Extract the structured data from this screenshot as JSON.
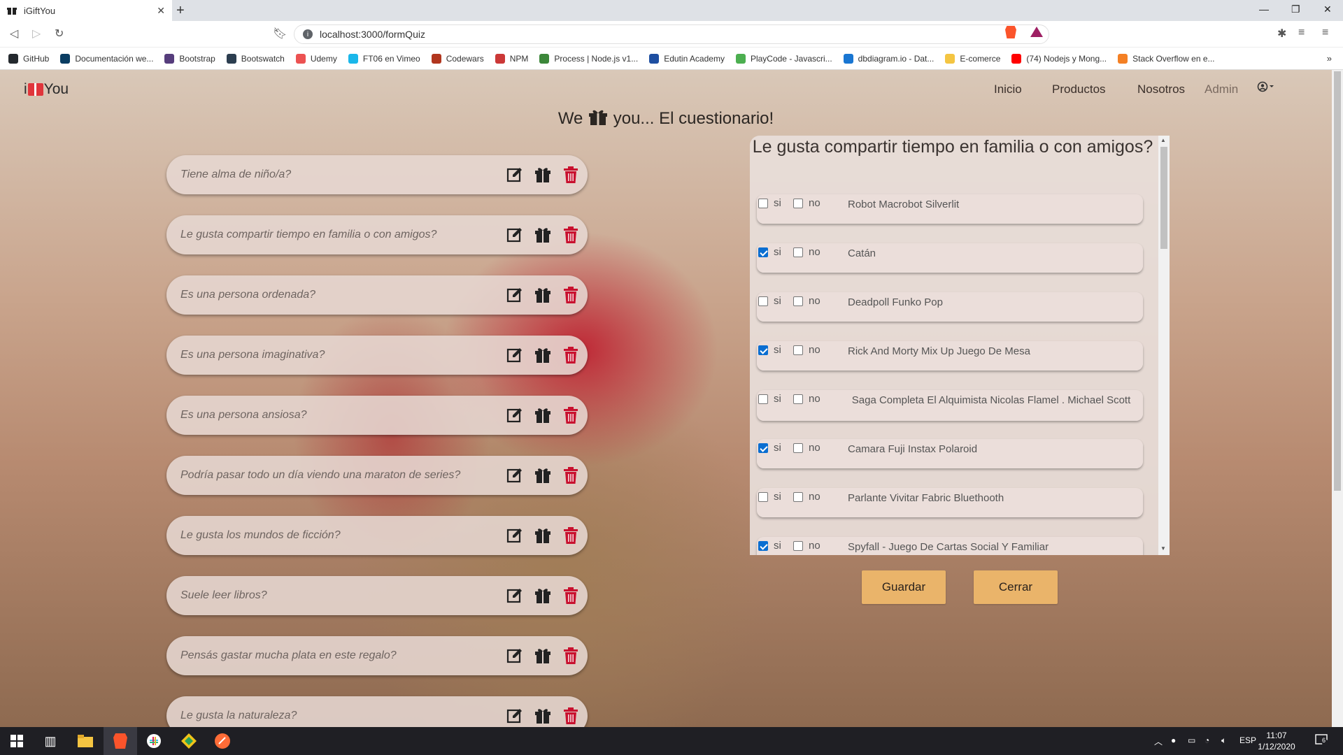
{
  "browser": {
    "tab_title": "iGiftYou",
    "url": "localhost:3000/formQuiz",
    "bookmarks": [
      {
        "label": "GitHub",
        "color": "#24292e"
      },
      {
        "label": "Documentación we...",
        "color": "#0a3d62"
      },
      {
        "label": "Bootstrap",
        "color": "#563d7c"
      },
      {
        "label": "Bootswatch",
        "color": "#2c3e50"
      },
      {
        "label": "Udemy",
        "color": "#ec5252"
      },
      {
        "label": "FT06 en Vimeo",
        "color": "#1ab7ea"
      },
      {
        "label": "Codewars",
        "color": "#b1361e"
      },
      {
        "label": "NPM",
        "color": "#cb3837"
      },
      {
        "label": "Process | Node.js v1...",
        "color": "#3c873a"
      },
      {
        "label": "Edutin Academy",
        "color": "#1e4fa1"
      },
      {
        "label": "PlayCode - Javascri...",
        "color": "#4caf50"
      },
      {
        "label": "dbdiagram.io - Dat...",
        "color": "#1976d2"
      },
      {
        "label": "E-comerce",
        "color": "#f4c542"
      },
      {
        "label": "(74) Nodejs y Mong...",
        "color": "#ff0000"
      },
      {
        "label": "Stack Overflow en e...",
        "color": "#f48024"
      }
    ]
  },
  "navbar": {
    "brand_left": "i",
    "brand_right": "You",
    "links": [
      "Inicio",
      "Productos",
      "Nosotros",
      "Admin"
    ]
  },
  "page": {
    "title_left": "We",
    "title_right": "you... El cuestionario!"
  },
  "questions": [
    "Tiene alma de niño/a?",
    "Le gusta compartir tiempo en familia o con amigos?",
    "Es una persona ordenada?",
    "Es una persona imaginativa?",
    "Es una persona ansiosa?",
    "Podría pasar todo un día viendo una maraton de series?",
    "Le gusta los mundos de ficción?",
    "Suele leer libros?",
    "Pensás gastar mucha plata en este regalo?",
    "Le gusta la naturaleza?"
  ],
  "panel": {
    "title": "Le gusta compartir tiempo en familia o con amigos?",
    "yes_label": "si",
    "no_label": "no",
    "products": [
      {
        "name": "Robot Macrobot Silverlit",
        "si": false,
        "no": false
      },
      {
        "name": "Catán",
        "si": true,
        "no": false
      },
      {
        "name": "Deadpoll Funko Pop",
        "si": false,
        "no": false
      },
      {
        "name": "Rick And Morty Mix Up Juego De Mesa",
        "si": true,
        "no": false
      },
      {
        "name": "Saga Completa El Alquimista Nicolas Flamel . Michael Scott",
        "si": false,
        "no": false
      },
      {
        "name": "Camara Fuji Instax Polaroid",
        "si": true,
        "no": false
      },
      {
        "name": "Parlante Vivitar Fabric Bluethooth",
        "si": false,
        "no": false
      },
      {
        "name": "Spyfall - Juego De Cartas Social Y Familiar",
        "si": true,
        "no": false
      }
    ]
  },
  "buttons": {
    "save": "Guardar",
    "close": "Cerrar"
  },
  "taskbar": {
    "lang": "ESP",
    "time": "11:07",
    "date": "1/12/2020",
    "notifications": "6"
  },
  "colors": {
    "accent_button": "#eab46a",
    "delete_icon": "#c8102e",
    "checkbox_checked": "#0a6ed1"
  }
}
